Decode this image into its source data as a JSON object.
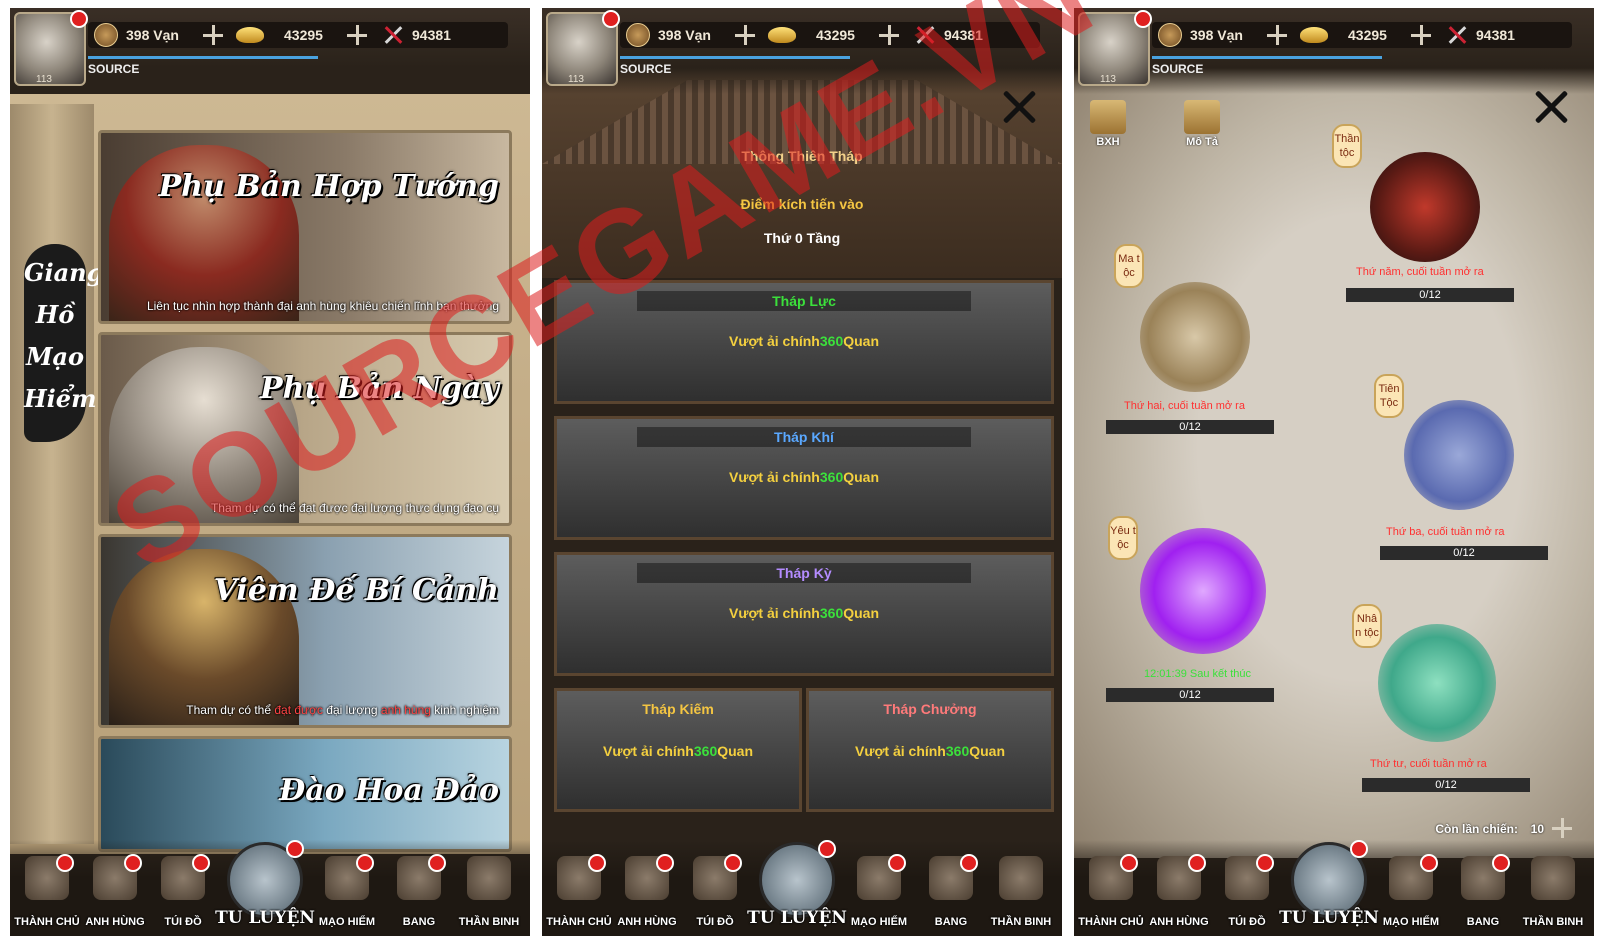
{
  "hud": {
    "level": "113",
    "source_label": "SOURCE",
    "copper": "398 Vạn",
    "gold": "43295",
    "power": "94381"
  },
  "nav": {
    "items": [
      "THÀNH CHỦ",
      "ANH HÙNG",
      "TÚI ĐỒ",
      "TU LUYỆN",
      "MẠO HIỂM",
      "BANG",
      "THẦN BINH"
    ]
  },
  "panel1": {
    "side_title": [
      "Giang",
      "Hồ",
      "Mạo",
      "Hiểm"
    ],
    "cards": [
      {
        "title": "Phụ Bản Hợp Tướng",
        "desc": "Liên tục nhìn hợp thành đại anh hùng khiêu chiến lĩnh bạn thưởng"
      },
      {
        "title": "Phụ Bản Ngày",
        "desc": "Tham dự có thể đạt được đại lượng thực dụng đạo cụ"
      },
      {
        "title": "Viêm Đế Bí Cảnh",
        "desc_pre": "Tham dự có thể ",
        "desc_hl1": "đạt được",
        "desc_mid": " đại lượng ",
        "desc_hl2": "anh hùng",
        "desc_post": " kinh nghiệm"
      },
      {
        "title": "Đào Hoa Đảo",
        "desc": ""
      }
    ]
  },
  "panel2": {
    "tower_name": "Thông Thiên Tháp",
    "entry_label": "Điểm kích tiến vào",
    "floor_label": "Thứ 0 Tầng",
    "floors": [
      {
        "name": "Tháp Lực",
        "color": "#3be03b"
      },
      {
        "name": "Tháp Khí",
        "color": "#5aa8ff"
      },
      {
        "name": "Tháp Kỳ",
        "color": "#b48cff"
      }
    ],
    "halves": [
      {
        "name": "Tháp Kiếm",
        "color": "#f4c542"
      },
      {
        "name": "Tháp Chưởng",
        "color": "#ff7a7a"
      }
    ],
    "challenge_pre": "Vượt ải chính",
    "challenge_num": "360",
    "challenge_post": "Quan"
  },
  "panel3": {
    "top_icons": [
      "BXH",
      "Mô Tả"
    ],
    "clans": [
      {
        "tag": "Thần tộc",
        "note": "Thứ năm, cuối tuần mở ra",
        "count": "0/12",
        "color": "#c0392b"
      },
      {
        "tag": "Ma tộc",
        "note": "Thứ hai, cuối tuần mở ra",
        "count": "0/12",
        "color": "#b08a50"
      },
      {
        "tag": "Tiên Tộc",
        "note": "Thứ ba, cuối tuần mở ra",
        "count": "0/12",
        "color": "#5a6ab0"
      },
      {
        "tag": "Yêu tộc",
        "note": "12:01:39 Sau kết thúc",
        "count": "0/12",
        "color": "#a020f0"
      },
      {
        "tag": "Nhân tộc",
        "note": "Thứ tư, cuối tuần mở ra",
        "count": "0/12",
        "color": "#3fa88a"
      }
    ],
    "fight_label": "Còn lần chiến:",
    "fight_count": "10"
  },
  "watermark": "SOURCEGAME.VN",
  "colors": {
    "badge": "#e02020",
    "highlight_green": "#3be03b",
    "challenge_yellow": "#f4d03f"
  }
}
